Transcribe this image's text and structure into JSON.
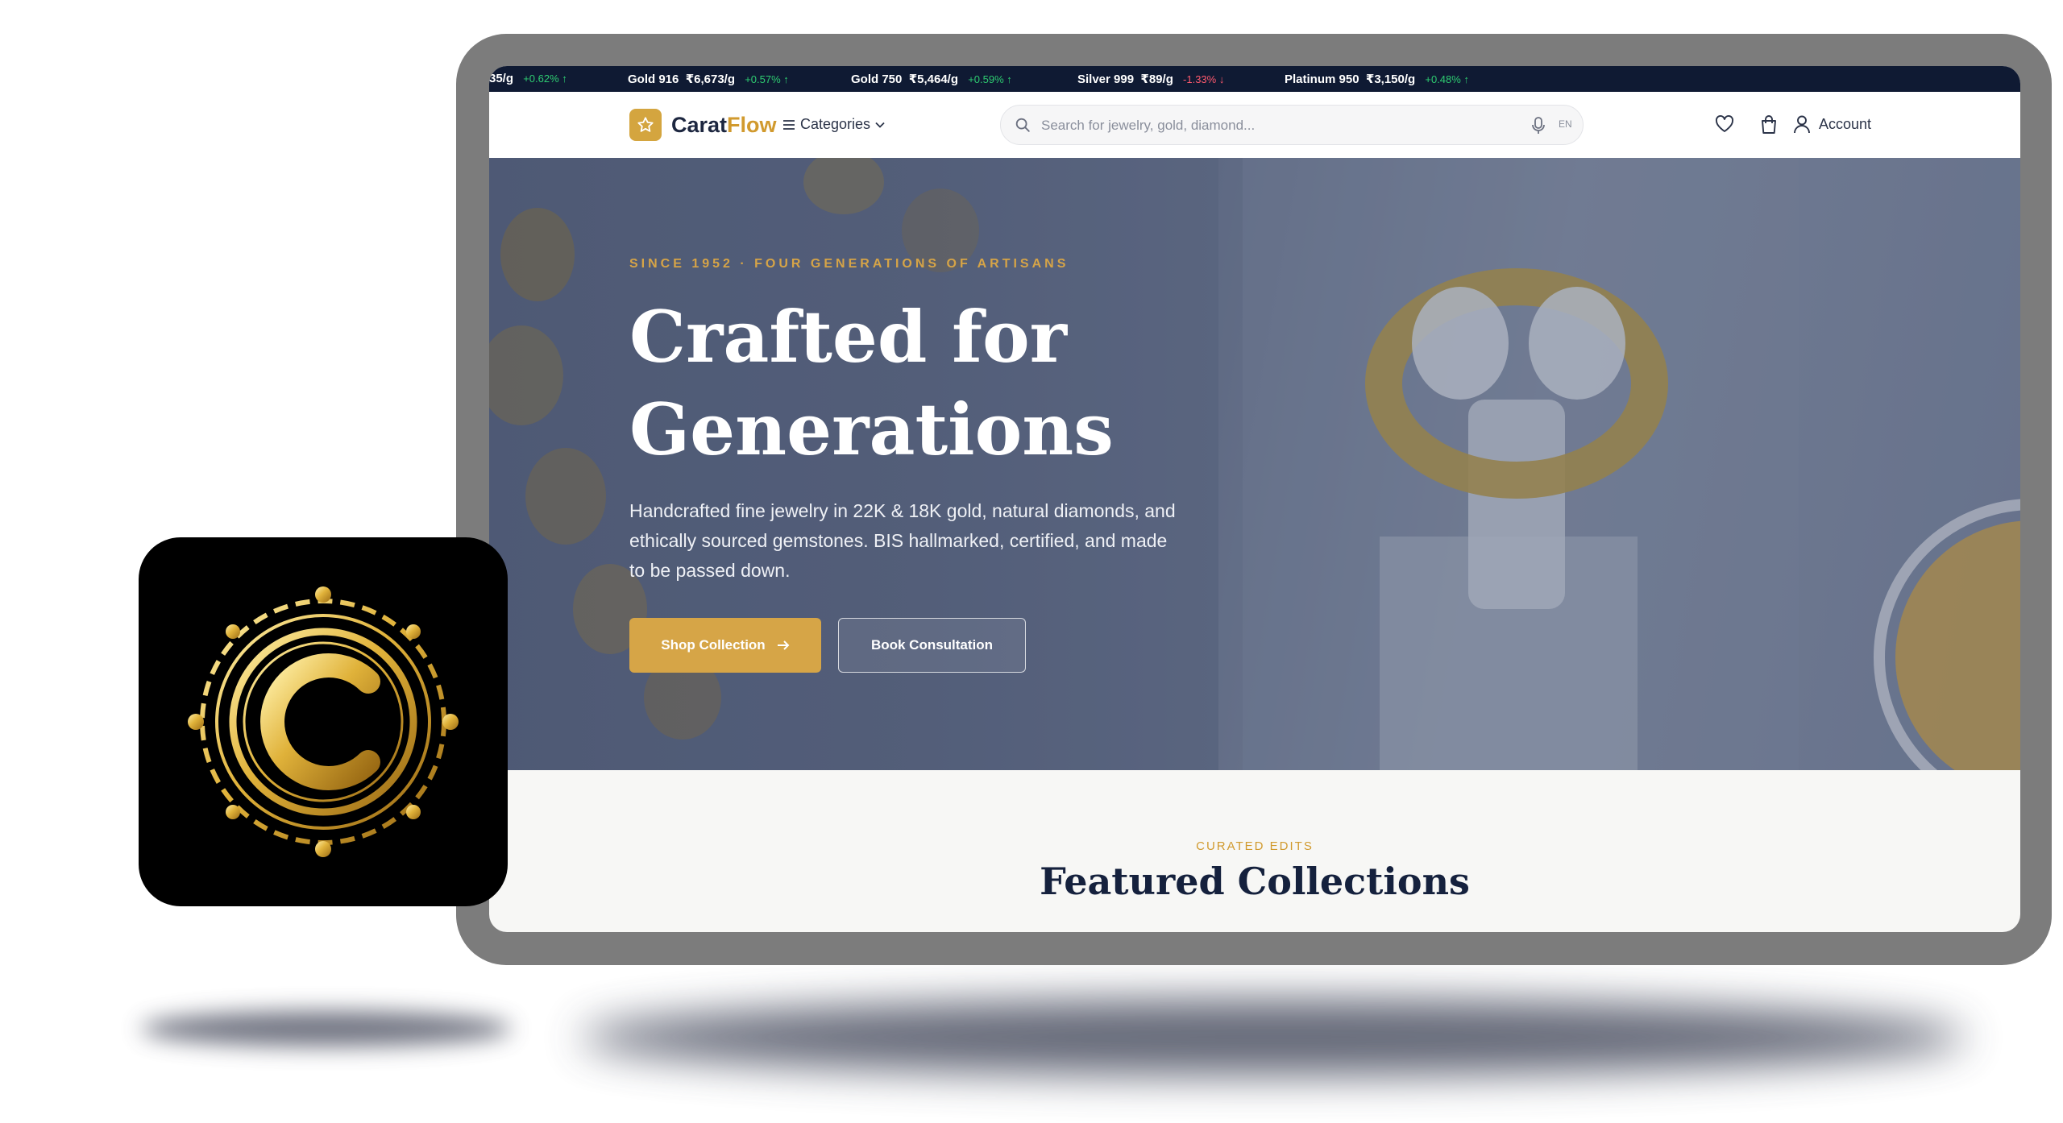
{
  "ticker": [
    {
      "label": "",
      "price": "35/g",
      "change": "+0.62% ↑",
      "dir": "up"
    },
    {
      "label": "Gold 916",
      "price": "₹6,673/g",
      "change": "+0.57% ↑",
      "dir": "up"
    },
    {
      "label": "Gold 750",
      "price": "₹5,464/g",
      "change": "+0.59% ↑",
      "dir": "up"
    },
    {
      "label": "Silver 999",
      "price": "₹89/g",
      "change": "-1.33% ↓",
      "dir": "down"
    },
    {
      "label": "Platinum 950",
      "price": "₹3,150/g",
      "change": "+0.48% ↑",
      "dir": "up"
    }
  ],
  "nav": {
    "logo_main": "Carat",
    "logo_accent": "Flow",
    "categories_label": "Categories",
    "search_placeholder": "Search for jewelry, gold, diamond...",
    "lang": "EN",
    "account_label": "Account"
  },
  "hero": {
    "eyebrow": "SINCE 1952 · FOUR GENERATIONS OF ARTISANS",
    "title": "Crafted for Generations",
    "subtitle": "Handcrafted fine jewelry in 22K & 18K gold, natural diamonds, and ethically sourced gemstones. BIS hallmarked, certified, and made to be passed down.",
    "primary_cta": "Shop Collection",
    "secondary_cta": "Book Consultation"
  },
  "featured": {
    "label": "CURATED EDITS",
    "title": "Featured Collections"
  },
  "app_icon": {
    "letter": "C"
  },
  "colors": {
    "gold": "#D6A547",
    "navy": "#15213D",
    "ticker_bg": "#0F1A33",
    "up": "#2ECC71",
    "down": "#FF5A6E"
  }
}
